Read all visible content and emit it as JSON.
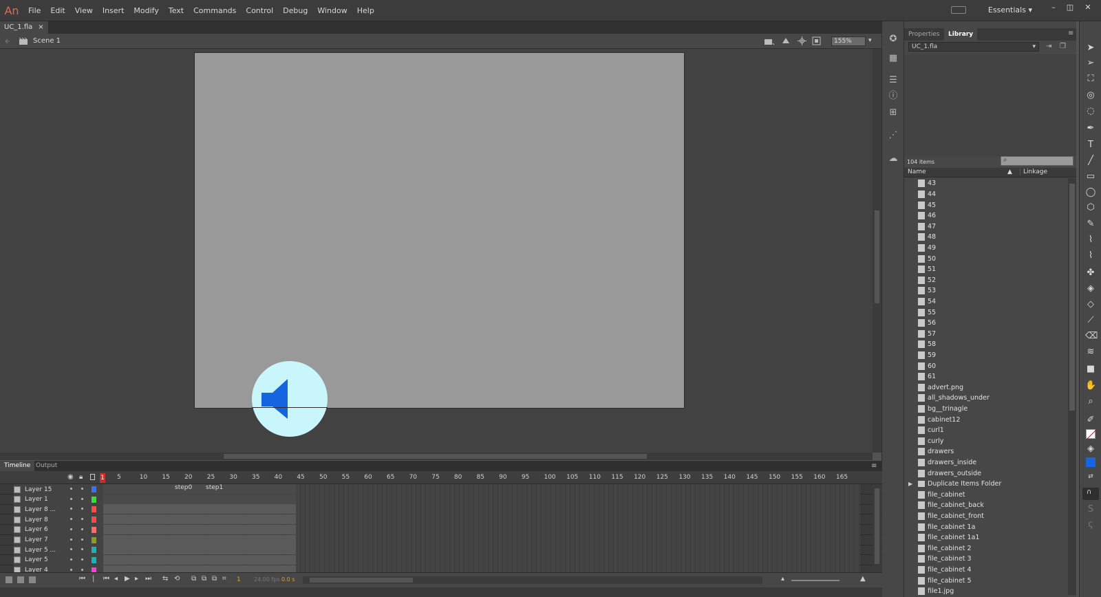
{
  "app": {
    "logo": "An",
    "workspace": "Essentials"
  },
  "menu": [
    "File",
    "Edit",
    "View",
    "Insert",
    "Modify",
    "Text",
    "Commands",
    "Control",
    "Debug",
    "Window",
    "Help"
  ],
  "window_controls": {
    "minimize": "–",
    "restore": "◫",
    "close": "✕"
  },
  "document": {
    "tab_label": "UC_1.fla",
    "tab_close": "×",
    "scene": "Scene 1",
    "zoom": "155%"
  },
  "colors": {
    "stage": "#999999",
    "sound_circle": "#c8f6fb",
    "speaker": "#1565e0",
    "playhead": "#c8302c"
  },
  "timeline": {
    "tabs": [
      "Timeline",
      "Output"
    ],
    "ruler": [
      "1",
      "5",
      "10",
      "15",
      "20",
      "25",
      "30",
      "35",
      "40",
      "45",
      "50",
      "55",
      "60",
      "65",
      "70",
      "75",
      "80",
      "85",
      "90",
      "95",
      "100",
      "105",
      "110",
      "115",
      "120",
      "125",
      "130",
      "135",
      "140",
      "145",
      "150",
      "155",
      "160",
      "165"
    ],
    "current_frame": "1",
    "layers": [
      {
        "name": "Layer 15",
        "color": "#3b6fff",
        "labels": [
          "step0",
          "step1"
        ]
      },
      {
        "name": "Layer 1",
        "color": "#3bdc3b",
        "labels": []
      },
      {
        "name": "Layer 8 ...",
        "color": "#ff4a4a",
        "labels": []
      },
      {
        "name": "Layer 8",
        "color": "#ff4a4a",
        "labels": []
      },
      {
        "name": "Layer 6",
        "color": "#ff6a6a",
        "labels": []
      },
      {
        "name": "Layer 7",
        "color": "#8a9e1a",
        "labels": []
      },
      {
        "name": "Layer 5 ...",
        "color": "#1ab4b4",
        "labels": []
      },
      {
        "name": "Layer 5",
        "color": "#1ab4b4",
        "labels": []
      },
      {
        "name": "Layer 4",
        "color": "#ff3ae0",
        "labels": []
      }
    ],
    "status": {
      "frame": "1",
      "fps": "24.00 fps",
      "time": "0.0 s"
    }
  },
  "panel": {
    "tabs": [
      "Properties",
      "Library"
    ],
    "library_select": "UC_1.fla",
    "items_count": "104 items",
    "col_name": "Name",
    "col_linkage": "Linkage",
    "items": [
      "43",
      "44",
      "45",
      "46",
      "47",
      "48",
      "49",
      "50",
      "51",
      "52",
      "53",
      "54",
      "55",
      "56",
      "57",
      "58",
      "59",
      "60",
      "61",
      "advert.png",
      "all_shadows_under",
      "bg__trinagle",
      "cabinet12",
      "curl1",
      "curly",
      "drawers",
      "drawers_inside",
      "drawers_outside",
      "Duplicate Items Folder",
      "file_cabinet",
      "file_cabinet_back",
      "file_cabinet_front",
      "file_cabinet 1a",
      "file_cabinet 1a1",
      "file_cabinet 2",
      "file_cabinet 3",
      "file_cabinet 4",
      "file_cabinet 5",
      "file1.jpg"
    ]
  }
}
